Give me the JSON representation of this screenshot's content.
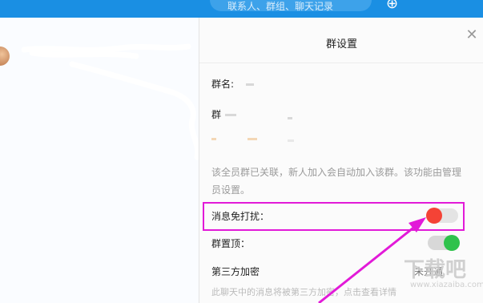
{
  "topbar": {
    "search_placeholder": "联系人、群组、聊天记录"
  },
  "left": {
    "chat_name": ""
  },
  "panel": {
    "title": "群设置",
    "group_name_label": "群名:",
    "group_label": "群",
    "hint_text": "该全员群已关联，新人加入会自动加入该群。该功能由管理员设置。",
    "mute_label": "消息免打扰：",
    "mute_enabled": false,
    "pin_label": "群置顶：",
    "pin_enabled": true,
    "third_party_label": "第三方加密",
    "third_party_status": "未开通",
    "bottom_text": "此聊天中的消息将被第三方加密，点击查看详情"
  },
  "watermark": {
    "text": "下载吧",
    "sub": "www.xiazaiba.com"
  },
  "colors": {
    "topbar": "#1a8fe3",
    "highlight": "#e21ad8",
    "toggle_off_knob": "#f44336",
    "toggle_on_knob": "#2fc24c"
  }
}
